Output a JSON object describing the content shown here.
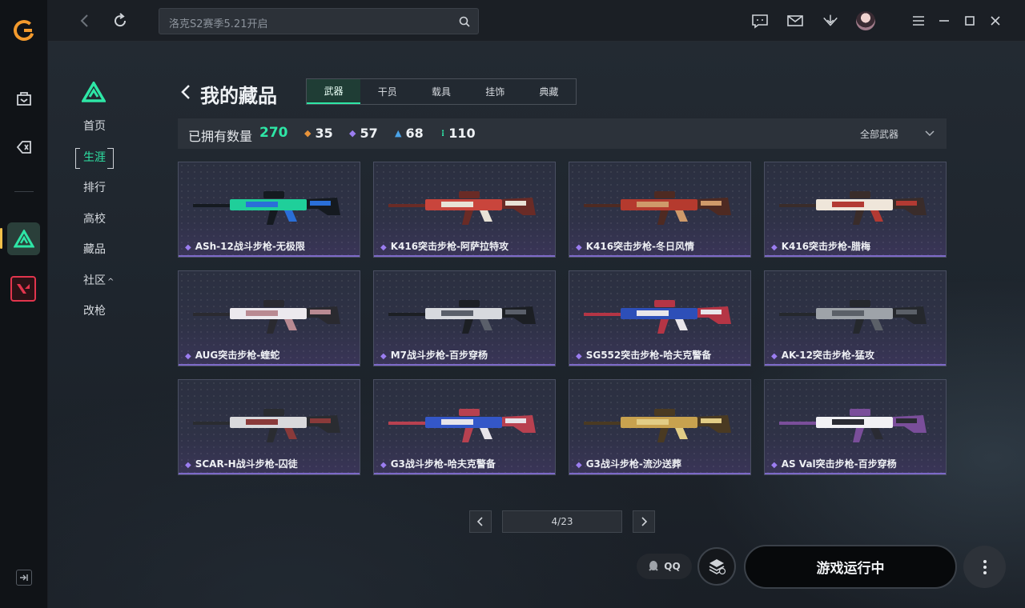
{
  "topbar": {
    "search_placeholder": "洛克S2赛季5.21开启",
    "icons": [
      "back-icon",
      "refresh-icon",
      "search-icon",
      "chat-icon",
      "mail-icon",
      "download-icon",
      "avatar",
      "menu-icon",
      "minimize-icon",
      "maximize-icon",
      "close-icon"
    ]
  },
  "sidebar": {
    "items": [
      {
        "label": "首页"
      },
      {
        "label": "生涯",
        "active": true
      },
      {
        "label": "排行"
      },
      {
        "label": "高校"
      },
      {
        "label": "藏品"
      },
      {
        "label": "社区",
        "suffix": "^"
      },
      {
        "label": "改枪"
      }
    ]
  },
  "page": {
    "title": "我的藏品",
    "tabs": [
      {
        "label": "武器",
        "active": true
      },
      {
        "label": "干员"
      },
      {
        "label": "载具"
      },
      {
        "label": "挂饰"
      },
      {
        "label": "典藏"
      }
    ]
  },
  "summary": {
    "owned_label": "已拥有数量",
    "owned_total": "270",
    "counts": [
      {
        "icon": "orange-diamond-icon",
        "value": "35",
        "color": "#e8933a"
      },
      {
        "icon": "purple-diamond-icon",
        "value": "57",
        "color": "#9b7df0"
      },
      {
        "icon": "blue-chevron-icon",
        "value": "68",
        "color": "#4aa3e8"
      },
      {
        "icon": "green-dots-icon",
        "value": "110",
        "color": "#2ee6a6"
      }
    ],
    "filter": "全部武器"
  },
  "items": [
    {
      "name": "ASh-12战斗步枪-无极限",
      "palette": [
        "#1fcf9a",
        "#2a6fd8",
        "#151a20"
      ]
    },
    {
      "name": "K416突击步枪-阿萨拉特攻",
      "palette": [
        "#c9453c",
        "#e8e2d6",
        "#6a2b26"
      ]
    },
    {
      "name": "K416突击步枪-冬日风情",
      "palette": [
        "#b53a2e",
        "#cf9a6a",
        "#4e2a22"
      ]
    },
    {
      "name": "K416突击步枪-腊梅",
      "palette": [
        "#efe6da",
        "#b33a33",
        "#3a2c2a"
      ]
    },
    {
      "name": "AUG突击步枪-蝰蛇",
      "palette": [
        "#ece9ee",
        "#b98a92",
        "#2a2a30"
      ]
    },
    {
      "name": "M7战斗步枪-百步穿杨",
      "palette": [
        "#d7d9de",
        "#5a5f6a",
        "#1c1f24"
      ]
    },
    {
      "name": "SG552突击步枪-哈夫克警备",
      "palette": [
        "#2d4fb8",
        "#e9e6ea",
        "#b53545"
      ]
    },
    {
      "name": "AK-12突击步枪-猛攻",
      "palette": [
        "#9ea3a9",
        "#5b6068",
        "#25282d"
      ]
    },
    {
      "name": "SCAR-H战斗步枪-囚徒",
      "palette": [
        "#d9d9dc",
        "#8a3a3a",
        "#2a2c31"
      ]
    },
    {
      "name": "G3战斗步枪-哈夫克警备",
      "palette": [
        "#3457c8",
        "#e7e4ea",
        "#b84150"
      ]
    },
    {
      "name": "G3战斗步枪-流沙送葬",
      "palette": [
        "#c8a24f",
        "#e2cd86",
        "#4a3a22"
      ]
    },
    {
      "name": "AS Val突击步枪-百步穿杨",
      "palette": [
        "#f1f1f4",
        "#2a2b33",
        "#7a4e9a"
      ]
    }
  ],
  "pager": {
    "text": "4/23"
  },
  "footer": {
    "qq_label": "QQ",
    "launch_label": "游戏运行中"
  }
}
